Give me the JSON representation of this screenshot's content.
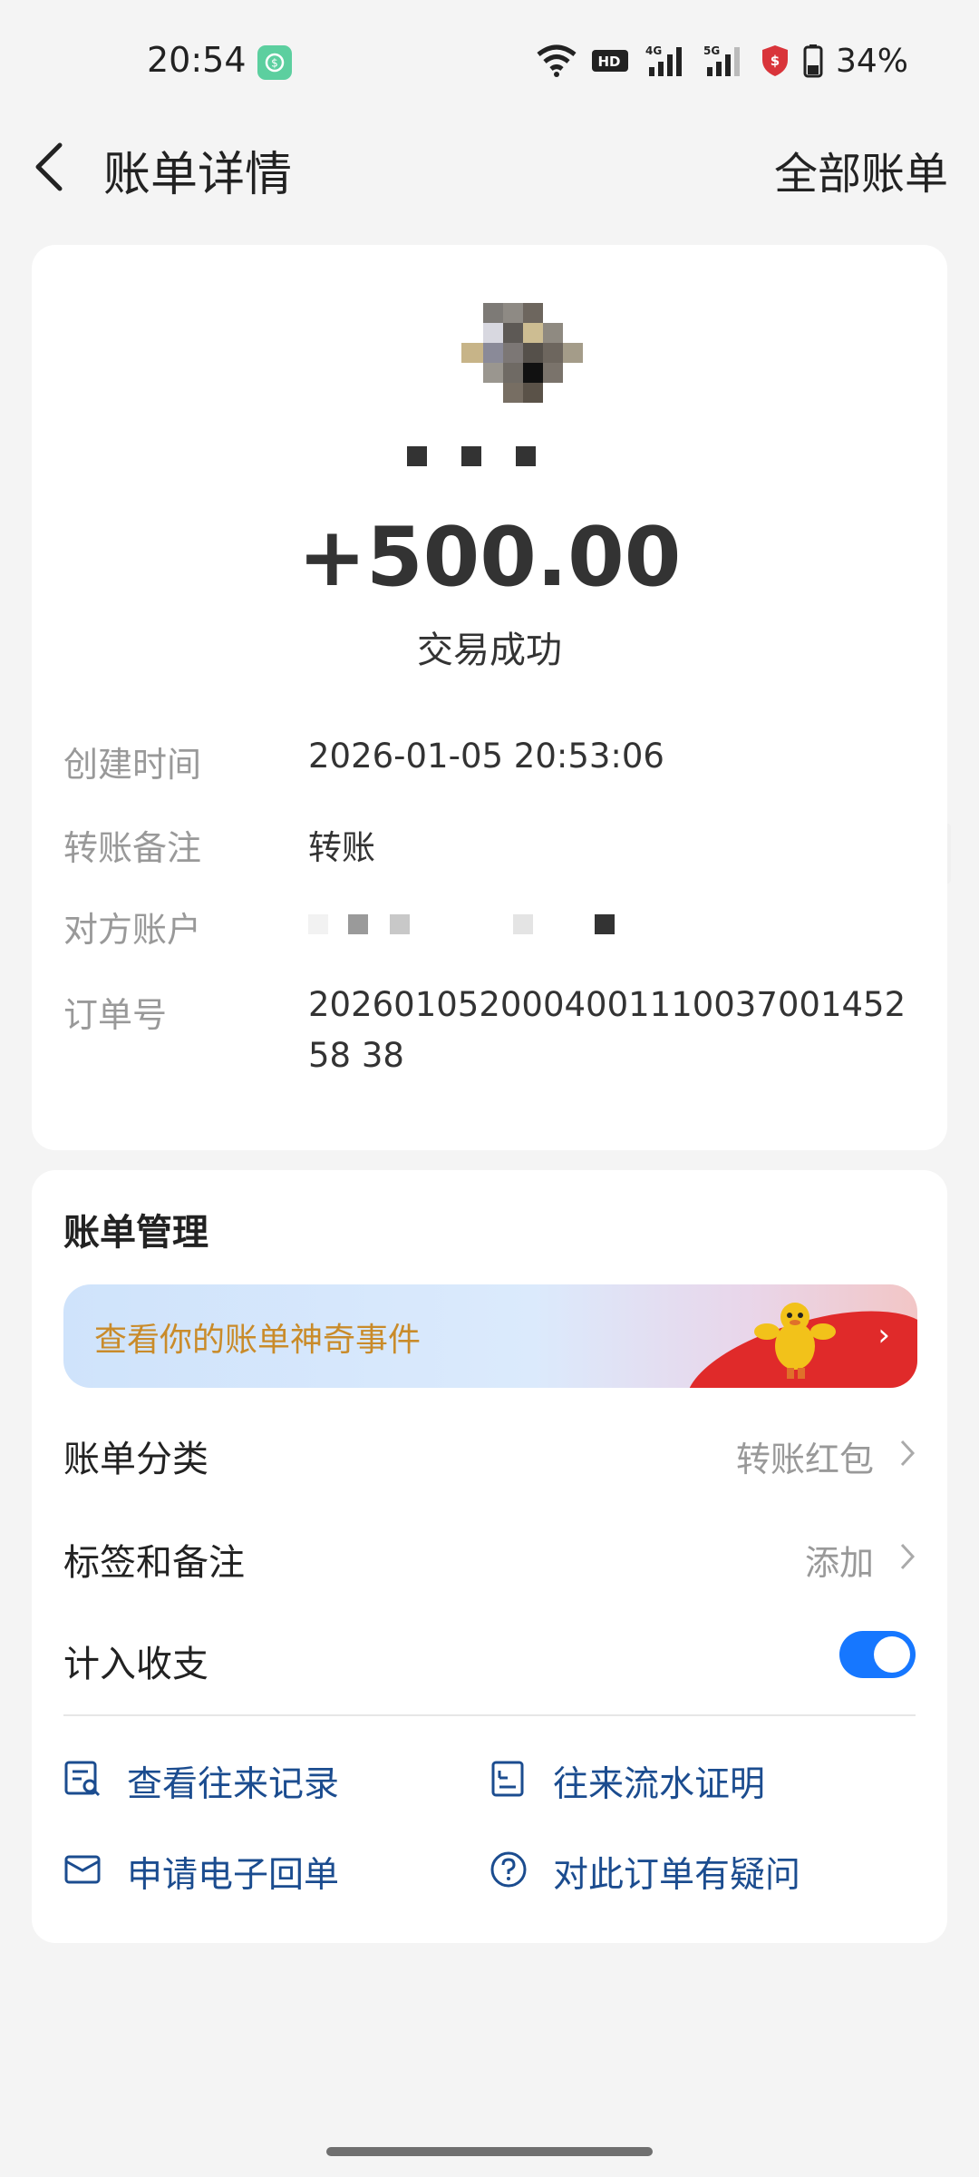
{
  "status_bar": {
    "time": "20:54",
    "network_hd": "HD",
    "signal1": "4G",
    "signal2": "5G",
    "battery": "34%",
    "icons": [
      "wifi-icon",
      "hd-icon",
      "signal-4g-icon",
      "signal-5g-icon",
      "shield-icon",
      "battery-icon"
    ]
  },
  "header": {
    "title": "账单详情",
    "right_link": "全部账单"
  },
  "transaction": {
    "amount": "+500.00",
    "status": "交易成功"
  },
  "details": [
    {
      "label": "创建时间",
      "value": "2026-01-05 20:53:06"
    },
    {
      "label": "转账备注",
      "value": "转账"
    },
    {
      "label": "对方账户",
      "value": ""
    },
    {
      "label": "订单号",
      "value": "202601052000400111003700145258 38"
    }
  ],
  "management": {
    "title": "账单管理",
    "banner_text": "查看你的账单神奇事件",
    "category_label": "账单分类",
    "category_value": "转账红包",
    "tags_label": "标签和备注",
    "tags_value": "添加",
    "count_label": "计入收支",
    "count_enabled": true
  },
  "actions": {
    "records": "查看往来记录",
    "proof": "往来流水证明",
    "receipt": "申请电子回单",
    "question": "对此订单有疑问"
  },
  "colors": {
    "accent": "#1677ff",
    "action_text": "#1b4c8f",
    "banner_text": "#c98b2a"
  }
}
